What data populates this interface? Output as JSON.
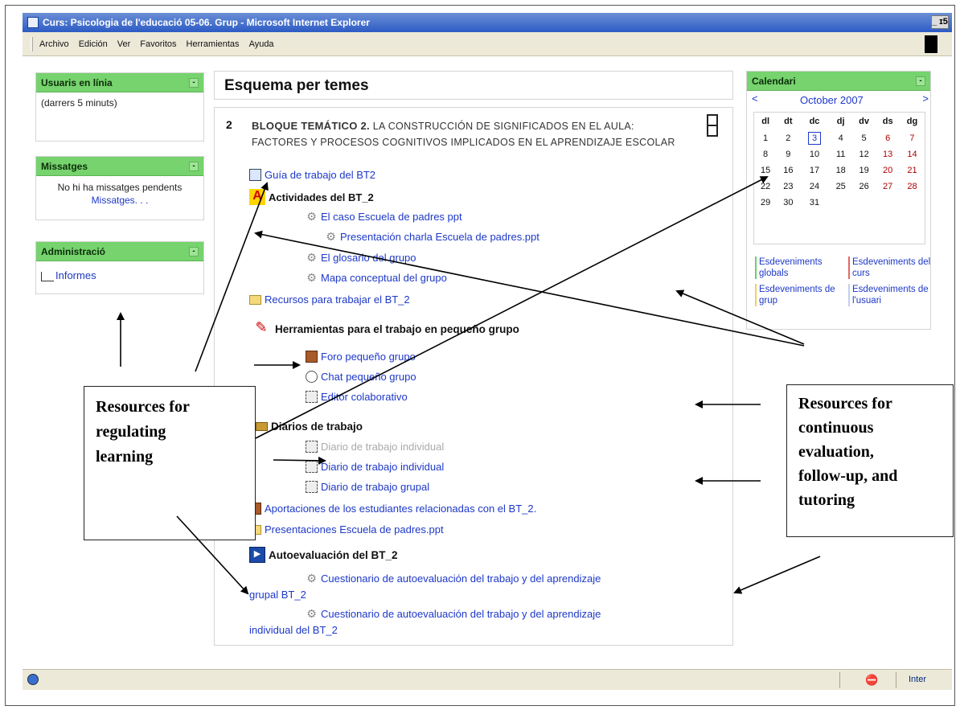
{
  "window": {
    "title": "Curs: Psicologia de l'educació 05-06. Grup - Microsoft Internet Explorer",
    "controls": "_ ɪ5",
    "menu": [
      "Archivo",
      "Edición",
      "Ver",
      "Favoritos",
      "Herramientas",
      "Ayuda"
    ],
    "status_zone": "Inter"
  },
  "blocks": {
    "online": {
      "title": "Usuaris en línia",
      "text": "(darrers 5 minuts)"
    },
    "messages": {
      "title": "Missatges",
      "text": "No hi ha missatges pendents",
      "link": "Missatges. . ."
    },
    "admin": {
      "title": "Administració",
      "link": "Informes"
    },
    "calendar": {
      "title": "Calendari",
      "prev": "<",
      "next": ">",
      "month": "October 2007",
      "days": [
        "dl",
        "dt",
        "dc",
        "dj",
        "dv",
        "ds",
        "dg"
      ],
      "weeks": [
        [
          "1",
          "2",
          "3",
          "4",
          "5",
          "6",
          "7"
        ],
        [
          "8",
          "9",
          "10",
          "11",
          "12",
          "13",
          "14"
        ],
        [
          "15",
          "16",
          "17",
          "18",
          "19",
          "20",
          "21"
        ],
        [
          "22",
          "23",
          "24",
          "25",
          "26",
          "27",
          "28"
        ],
        [
          "29",
          "30",
          "31",
          "",
          "",
          "",
          ""
        ]
      ],
      "legend": {
        "global": "Esdeveniments globals",
        "course": "Esdeveniments del curs",
        "group": "Esdeveniments de grup",
        "user": "Esdeveniments de l'usuari"
      }
    }
  },
  "main": {
    "heading": "Esquema per temes",
    "section_number": "2",
    "section_title_bold": "BLOQUE TEMÁTICO 2.",
    "section_title_rest": " LA CONSTRUCCIÓN DE SIGNIFICADOS EN EL AULA: FACTORES Y PROCESOS COGNITIVOS IMPLICADOS EN EL APRENDIZAJE ESCOLAR",
    "items": {
      "guia": "Guía de trabajo del BT2",
      "actividades": "Actividades del BT_2",
      "caso": "El caso Escuela de padres ppt",
      "presentacion_charla": "Presentación charla Escuela de padres.ppt",
      "glosario": "El glosario del grupo",
      "mapa": "Mapa conceptual del grupo",
      "recursos": "Recursos para trabajar el BT_2",
      "herramientas": "Herramientas para el trabajo en pequeño grupo",
      "foro": "Foro pequeño grupo",
      "chat": "Chat pequeño grupo",
      "editor": "Editor colaborativo",
      "diarios": "Diarios de trabajo",
      "diario_ind_dim": "Diario de trabajo individual",
      "diario_ind": "Diario de trabajo individual",
      "diario_grupal": "Diario de trabajo grupal",
      "aportaciones": "Aportaciones de los estudiantes relacionadas con el BT_2.",
      "presentaciones": "Presentaciones Escuela de padres.ppt",
      "autoevaluacion": "Autoevaluación del BT_2",
      "cuest_grupal_1": "Cuestionario de autoevaluación del trabajo y del aprendizaje",
      "cuest_grupal_2": "grupal BT_2",
      "cuest_ind_1": "Cuestionario de autoevaluación del trabajo y del aprendizaje",
      "cuest_ind_2": "individual del BT_2"
    }
  },
  "annotations": {
    "left": [
      "Resources for",
      "regulating",
      "learning"
    ],
    "right": [
      "Resources for",
      "continuous",
      "evaluation,",
      "follow-up, and",
      "tutoring"
    ]
  }
}
